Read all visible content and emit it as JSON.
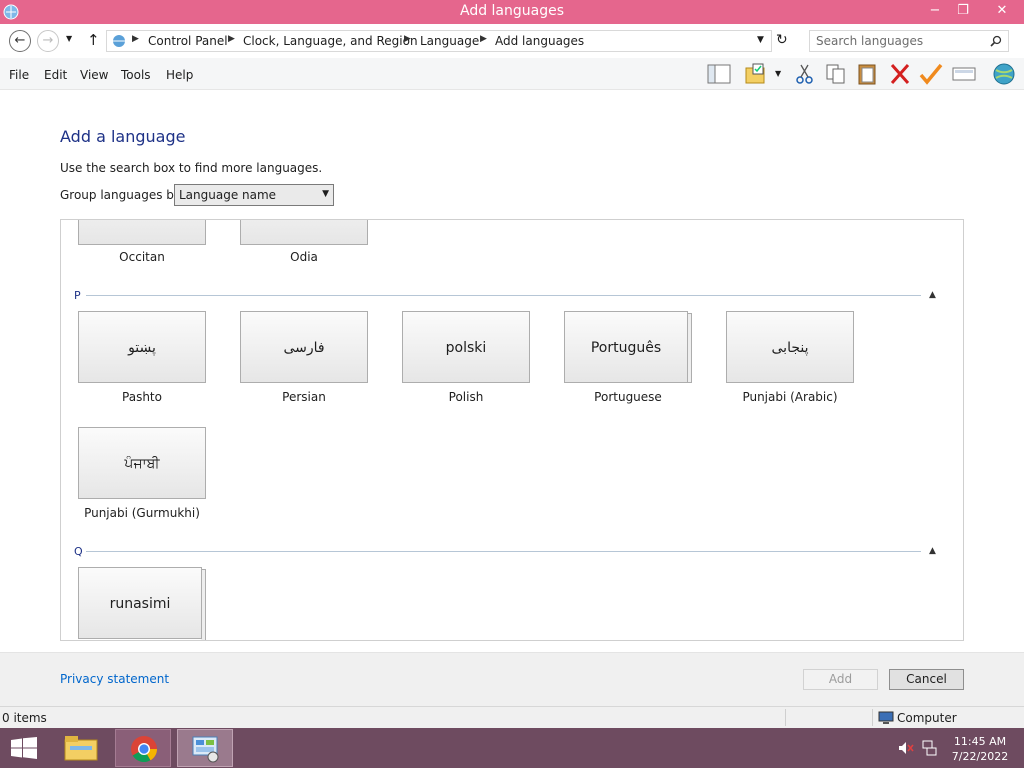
{
  "window": {
    "title": "Add languages",
    "minimize": "−",
    "restore": "❐",
    "close": "✕"
  },
  "address": {
    "crumbs": [
      "Control Panel",
      "Clock, Language, and Region",
      "Language",
      "Add languages"
    ],
    "search_placeholder": "Search languages"
  },
  "menu": [
    "File",
    "Edit",
    "View",
    "Tools",
    "Help"
  ],
  "page": {
    "heading": "Add a language",
    "hint": "Use the search box to find more languages.",
    "group_label": "Group languages by:",
    "group_value": "Language name"
  },
  "languages": {
    "top_row": [
      {
        "name": "Occitan"
      },
      {
        "name": "Odia"
      }
    ],
    "group_p_letter": "P",
    "group_p": [
      {
        "native": "پښتو",
        "name": "Pashto"
      },
      {
        "native": "فارسی",
        "name": "Persian"
      },
      {
        "native": "polski",
        "name": "Polish"
      },
      {
        "native": "Português",
        "name": "Portuguese"
      },
      {
        "native": "پنجابی",
        "name": "Punjabi (Arabic)"
      },
      {
        "native": "ਪੰਜਾਬੀ",
        "name": "Punjabi (Gurmukhi)"
      }
    ],
    "group_q_letter": "Q",
    "group_q": [
      {
        "native": "runasimi"
      }
    ]
  },
  "footer": {
    "privacy": "Privacy statement",
    "add": "Add",
    "cancel": "Cancel"
  },
  "status": {
    "items": "0 items",
    "location": "Computer"
  },
  "taskbar": {
    "time": "11:45 AM",
    "date": "7/22/2022"
  },
  "colors": {
    "titlebar": "#e5668d",
    "taskbar": "#6e4b60",
    "heading": "#1e3287",
    "link": "#0066cc"
  }
}
